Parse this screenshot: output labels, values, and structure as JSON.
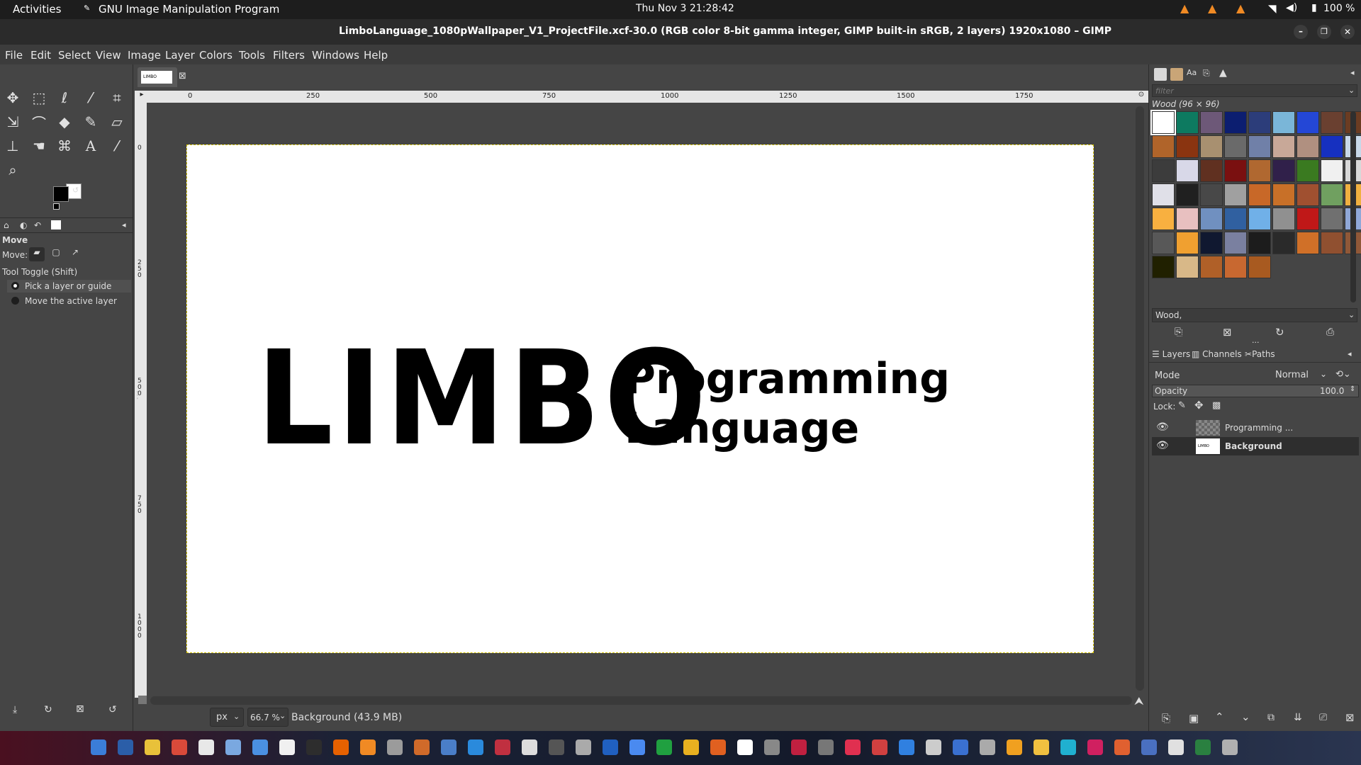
{
  "topbar": {
    "activities": "Activities",
    "app_name": "GNU Image Manipulation Program",
    "clock": "Thu Nov 3  21:28:42",
    "battery": "100 %"
  },
  "window": {
    "title": "LimboLanguage_1080pWallpaper_V1_ProjectFile.xcf-30.0 (RGB color 8-bit gamma integer, GIMP built-in sRGB, 2 layers) 1920x1080 – GIMP"
  },
  "menu": {
    "items": [
      "File",
      "Edit",
      "Select",
      "View",
      "Image",
      "Layer",
      "Colors",
      "Tools",
      "Filters",
      "Windows",
      "Help"
    ]
  },
  "tool_options": {
    "title": "Move",
    "move_label": "Move:",
    "toggle_label": "Tool Toggle  (Shift)",
    "option_1": "Pick a layer or guide",
    "option_2": "Move the active layer"
  },
  "rulers": {
    "h_ticks": [
      "0",
      "250",
      "500",
      "750",
      "1000",
      "1250",
      "1500",
      "1750"
    ],
    "v_ticks": [
      "0",
      "2\n5\n0",
      "5\n0\n0",
      "7\n5\n0",
      "1\n0\n0\n0"
    ]
  },
  "canvas": {
    "logo_text": "LIMBO",
    "line1": "Programming",
    "line2": "Language"
  },
  "statusbar": {
    "unit": "px",
    "zoom": "66.7 %",
    "info": "Background (43.9 MB)"
  },
  "patterns": {
    "filter_placeholder": "filter",
    "current": "Wood (96 × 96)",
    "selected_name": "Wood,"
  },
  "layers_panel": {
    "tabs": [
      "Layers",
      "Channels",
      "Paths"
    ],
    "mode_label": "Mode",
    "mode_value": "Normal",
    "opacity_label": "Opacity",
    "opacity_value": "100.0",
    "lock_label": "Lock:",
    "layers": [
      {
        "name": "Programming ...",
        "visible": true
      },
      {
        "name": "Background",
        "visible": true
      }
    ]
  },
  "colors": {
    "foreground": "#000000",
    "background": "#ffffff",
    "accent": "#e66100"
  }
}
